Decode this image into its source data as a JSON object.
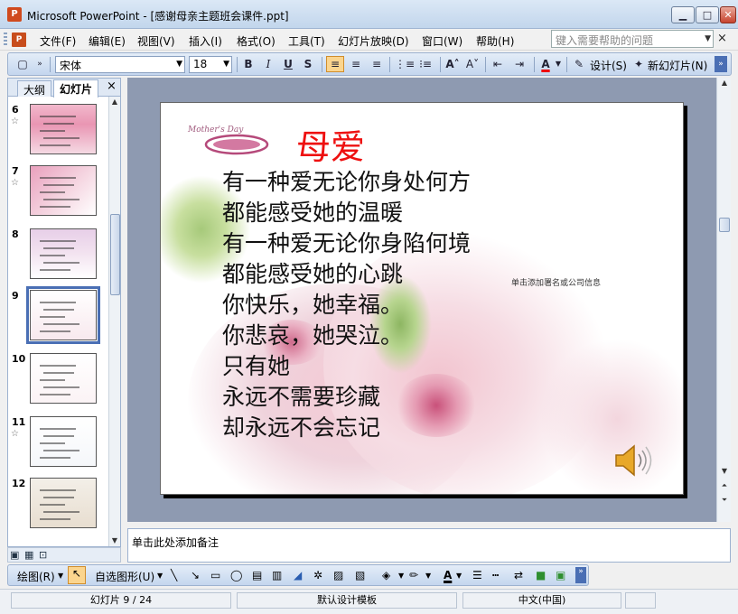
{
  "window": {
    "title": "Microsoft PowerPoint - [感谢母亲主题班会课件.ppt]",
    "app_icon_letter": "P"
  },
  "menu": {
    "items": [
      "文件(F)",
      "编辑(E)",
      "视图(V)",
      "插入(I)",
      "格式(O)",
      "工具(T)",
      "幻灯片放映(D)",
      "窗口(W)",
      "帮助(H)"
    ],
    "help_placeholder": "键入需要帮助的问题",
    "close_glyph": "×"
  },
  "format_toolbar": {
    "font_name": "宋体",
    "font_size": "18",
    "design_label": "设计(S)",
    "new_slide_label": "新幻灯片(N)"
  },
  "left_pane": {
    "tabs": [
      "大纲",
      "幻灯片"
    ],
    "close_glyph": "×",
    "slides": [
      {
        "num": "6",
        "has_anim": true
      },
      {
        "num": "7",
        "has_anim": true
      },
      {
        "num": "8",
        "has_anim": false
      },
      {
        "num": "9",
        "has_anim": false
      },
      {
        "num": "10",
        "has_anim": false
      },
      {
        "num": "11",
        "has_anim": true
      },
      {
        "num": "12",
        "has_anim": false
      }
    ],
    "selected_slide": "9"
  },
  "slide": {
    "title": "母爱",
    "lines": [
      "有一种爱无论你身处何方",
      "都能感受她的温暖",
      "有一种爱无论你身陷何境",
      "都能感受她的心跳",
      "你快乐，她幸福。",
      "你悲哀，她哭泣。",
      "只有她",
      "永远不需要珍藏",
      "却永远不会忘记"
    ],
    "note_text": "单击添加署名或公司信息",
    "logo_text": "Mother's Day"
  },
  "notes": {
    "placeholder": "单击此处添加备注"
  },
  "drawing_toolbar": {
    "draw_label": "绘图(R)",
    "autoshape_label": "自选图形(U)"
  },
  "status": {
    "slide_info": "幻灯片 9 / 24",
    "template": "默认设计模板",
    "language": "中文(中国)"
  },
  "colors": {
    "title_red": "#ee1010",
    "selection_blue": "#4a6fb4",
    "toolbar_blue": "#c4d6ee"
  }
}
